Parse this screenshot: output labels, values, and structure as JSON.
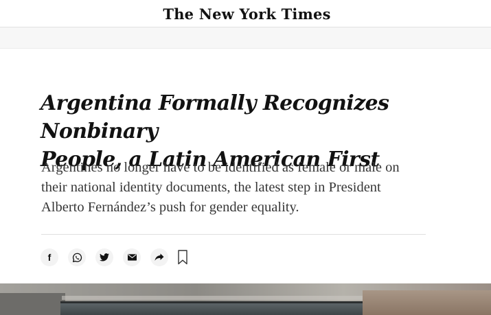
{
  "masthead": {
    "logo_text": "The New York Times"
  },
  "article": {
    "headline_line1": "Argentina Formally Recognizes Nonbinary",
    "headline_line2": "People, a Latin American First",
    "summary_line1": "Argentines no longer have to be identified as female or male on",
    "summary_line2": "their national identity documents, the latest step in President",
    "summary_line3": "Alberto Fernández’s push for gender equality."
  },
  "share_tools": {
    "facebook_glyph": "f",
    "icons": [
      "facebook-icon",
      "whatsapp-icon",
      "twitter-icon",
      "email-icon",
      "share-arrow-icon",
      "bookmark-icon"
    ]
  },
  "colors": {
    "text": "#121212",
    "summary": "#363636",
    "button_bg": "#f3f3f3"
  }
}
